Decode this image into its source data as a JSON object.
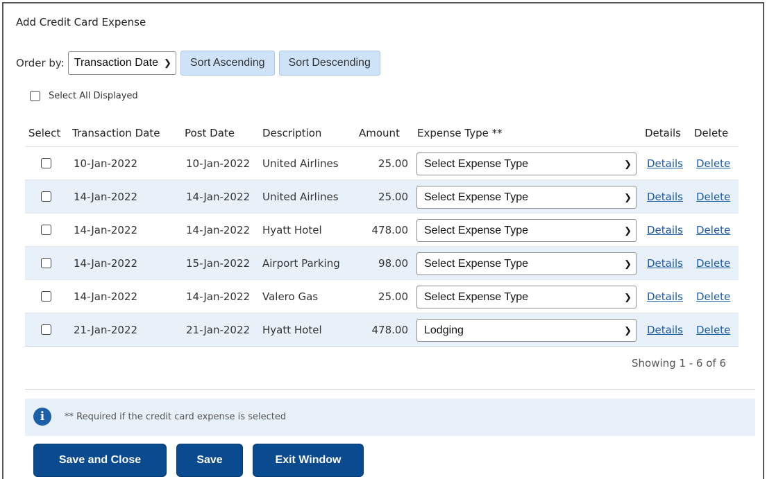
{
  "window": {
    "title": "Add Credit Card Expense"
  },
  "order": {
    "label": "Order by:",
    "selected": "Transaction Date",
    "sort_ascending": "Sort Ascending",
    "sort_descending": "Sort Descending"
  },
  "select_all": {
    "label": "Select All Displayed",
    "checked": false
  },
  "table": {
    "headers": {
      "select": "Select",
      "transaction_date": "Transaction Date",
      "post_date": "Post Date",
      "description": "Description",
      "amount": "Amount",
      "expense_type": "Expense Type **",
      "details": "Details",
      "delete": "Delete"
    },
    "rows": [
      {
        "checked": false,
        "transaction_date": "10-Jan-2022",
        "post_date": "10-Jan-2022",
        "description": "United Airlines",
        "amount": "25.00",
        "expense_type": "Select Expense Type",
        "details": "Details",
        "delete": "Delete"
      },
      {
        "checked": false,
        "transaction_date": "14-Jan-2022",
        "post_date": "14-Jan-2022",
        "description": "United Airlines",
        "amount": "25.00",
        "expense_type": "Select Expense Type",
        "details": "Details",
        "delete": "Delete"
      },
      {
        "checked": false,
        "transaction_date": "14-Jan-2022",
        "post_date": "14-Jan-2022",
        "description": "Hyatt Hotel",
        "amount": "478.00",
        "expense_type": "Select Expense Type",
        "details": "Details",
        "delete": "Delete"
      },
      {
        "checked": false,
        "transaction_date": "14-Jan-2022",
        "post_date": "15-Jan-2022",
        "description": "Airport Parking",
        "amount": "98.00",
        "expense_type": "Select Expense Type",
        "details": "Details",
        "delete": "Delete"
      },
      {
        "checked": false,
        "transaction_date": "14-Jan-2022",
        "post_date": "14-Jan-2022",
        "description": "Valero Gas",
        "amount": "25.00",
        "expense_type": "Select Expense Type",
        "details": "Details",
        "delete": "Delete"
      },
      {
        "checked": false,
        "transaction_date": "21-Jan-2022",
        "post_date": "21-Jan-2022",
        "description": "Hyatt Hotel",
        "amount": "478.00",
        "expense_type": "Lodging",
        "details": "Details",
        "delete": "Delete"
      }
    ]
  },
  "pagination": {
    "text": "Showing 1 - 6 of 6"
  },
  "note": {
    "icon": "info-icon",
    "text": "** Required if the credit card expense is selected"
  },
  "buttons": {
    "save_and_close": "Save and Close",
    "save": "Save",
    "exit_window": "Exit Window"
  },
  "colors": {
    "primary_button": "#0a4a8f",
    "sort_button": "#cfe3f8",
    "row_alt": "#e8f0fa",
    "link": "#1a5aa6"
  }
}
